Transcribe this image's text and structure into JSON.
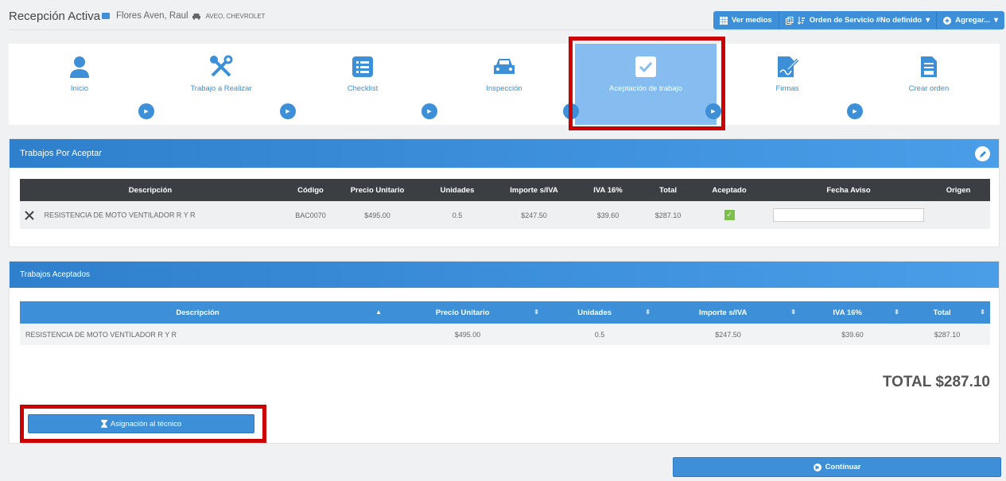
{
  "header": {
    "title": "Recepción Activa",
    "client_name": "Flores Aven, Raul",
    "vehicle": "AVEO, CHEVROLET",
    "buttons": {
      "ver_medios": "Ver medios",
      "orden_servicio": "Orden de Servicio #No definido",
      "agregar": "Agregar..."
    }
  },
  "steps": [
    {
      "label": "Inicio",
      "icon": "user-icon"
    },
    {
      "label": "Trabajo a Realizar",
      "icon": "tools-icon"
    },
    {
      "label": "Checklist",
      "icon": "list-icon"
    },
    {
      "label": "Inspección",
      "icon": "car-icon"
    },
    {
      "label": "Aceptación de trabajo",
      "icon": "checkbox-icon",
      "active": true
    },
    {
      "label": "Firmas",
      "icon": "signature-icon"
    },
    {
      "label": "Crear orden",
      "icon": "document-icon"
    }
  ],
  "pending": {
    "title": "Trabajos Por Aceptar",
    "columns": [
      "Descripción",
      "Código",
      "Precio Unitario",
      "Unidades",
      "Importe s/IVA",
      "IVA 16%",
      "Total",
      "Aceptado",
      "Fecha Aviso",
      "Origen"
    ],
    "rows": [
      {
        "descripcion": "RESISTENCIA DE MOTO VENTILADOR R Y R",
        "codigo": "BAC0070",
        "precio": "$495.00",
        "unidades": "0.5",
        "importe": "$247.50",
        "iva": "$39.60",
        "total": "$287.10",
        "aceptado": true,
        "fecha": ""
      }
    ]
  },
  "accepted": {
    "title": "Trabajos Aceptados",
    "columns": [
      "Descripción",
      "Precio Unitario",
      "Unidades",
      "Importe s/IVA",
      "IVA 16%",
      "Total"
    ],
    "rows": [
      {
        "descripcion": "RESISTENCIA DE MOTO VENTILADOR R Y R",
        "precio": "$495.00",
        "unidades": "0.5",
        "importe": "$247.50",
        "iva": "$39.60",
        "total": "$287.10"
      }
    ],
    "total_label": "TOTAL $287.10",
    "assign_button": "Asignación al técnico"
  },
  "footer": {
    "continue_button": "Continuar"
  },
  "colors": {
    "primary": "#3d8fd8",
    "active_step": "#85bdf0",
    "highlight": "#cc0000",
    "check": "#7cc04b"
  }
}
